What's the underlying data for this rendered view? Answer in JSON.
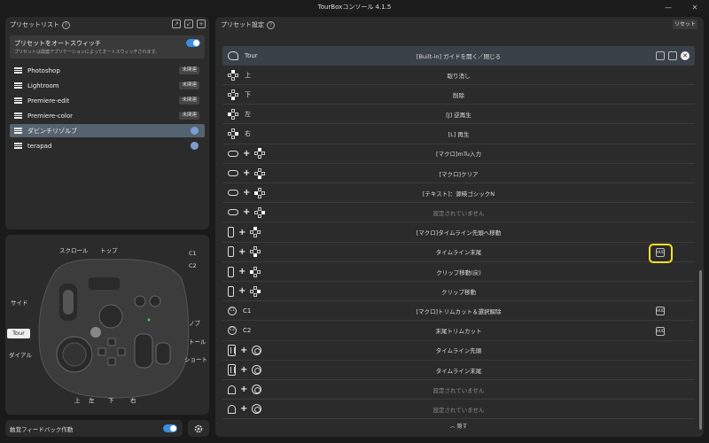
{
  "window": {
    "title": "TourBoxコンソール 4.1.5",
    "minimize": "—",
    "close": "✕"
  },
  "left_panel": {
    "header": "プリセットリスト",
    "help": "?",
    "auto_switch": {
      "title": "プリセットをオートスウィッチ",
      "description": "プリセットは関連アプリケーションによってオートスウィッチされます。",
      "enabled": true
    },
    "presets": [
      {
        "name": "Photoshop",
        "badge": "未関連"
      },
      {
        "name": "Lightroom",
        "badge": "未関連"
      },
      {
        "name": "Premiere-edit",
        "badge": "未関連"
      },
      {
        "name": "Premiere-color",
        "badge": "未関連"
      },
      {
        "name": "ダビンチリゾルブ",
        "badge": "",
        "selected": true
      },
      {
        "name": "terapad",
        "badge": ""
      }
    ]
  },
  "device": {
    "labels": {
      "scroll": "スクロール",
      "top": "トップ",
      "c1": "C1",
      "c2": "C2",
      "side": "サイド",
      "knob": "ノブ",
      "tour": "Tour",
      "tall": "トール",
      "dial": "ダイアル",
      "short": "ショート",
      "up": "上",
      "left": "左",
      "down": "下",
      "right": "右"
    }
  },
  "bottom": {
    "haptic_label": "触覚フィードバック作動",
    "haptic_enabled": true
  },
  "right_panel": {
    "header": "プリセット設定",
    "help": "?",
    "reset": "リセット",
    "rows": [
      {
        "ctl": "Tour",
        "label": "[Built-in] ガイドを開く／閉じる",
        "selected": true
      },
      {
        "ctl": "上",
        "label": "取り消し"
      },
      {
        "ctl": "下",
        "label": "削除"
      },
      {
        "ctl": "左",
        "label": "[J] 逆再生"
      },
      {
        "ctl": "右",
        "label": "[L] 再生"
      },
      {
        "ctl": "",
        "label": "[マクロ]mTu入力"
      },
      {
        "ctl": "",
        "label": "[マクロ]クリア"
      },
      {
        "ctl": "",
        "label": "[テキスト]：源暎ゴシックN"
      },
      {
        "ctl": "",
        "label": "設定されていません",
        "dim": true
      },
      {
        "ctl": "",
        "label": "[マクロ]タイムライン先頭へ移動"
      },
      {
        "ctl": "",
        "label": "タイムライン末尾",
        "badge": "HUD"
      },
      {
        "ctl": "",
        "label": "クリップ移動(戻)"
      },
      {
        "ctl": "",
        "label": "クリップ移動"
      },
      {
        "ctl": "C1",
        "label": "[マクロ]トリムカット＆選択解除",
        "badge": "HUD"
      },
      {
        "ctl": "C2",
        "label": "末尾トリムカット",
        "badge": "HUD"
      },
      {
        "ctl": "",
        "label": "タイムライン先頭"
      },
      {
        "ctl": "",
        "label": "タイムライン末尾"
      },
      {
        "ctl": "",
        "label": "設定されていません",
        "dim": true
      },
      {
        "ctl": "",
        "label": "設定されていません",
        "dim": true
      }
    ],
    "collapse": "隠す"
  },
  "colors": {
    "accent": "#3a8de0",
    "highlight": "#f6e21c",
    "selected_row": "#3b4148",
    "selected_preset": "#55626f"
  }
}
